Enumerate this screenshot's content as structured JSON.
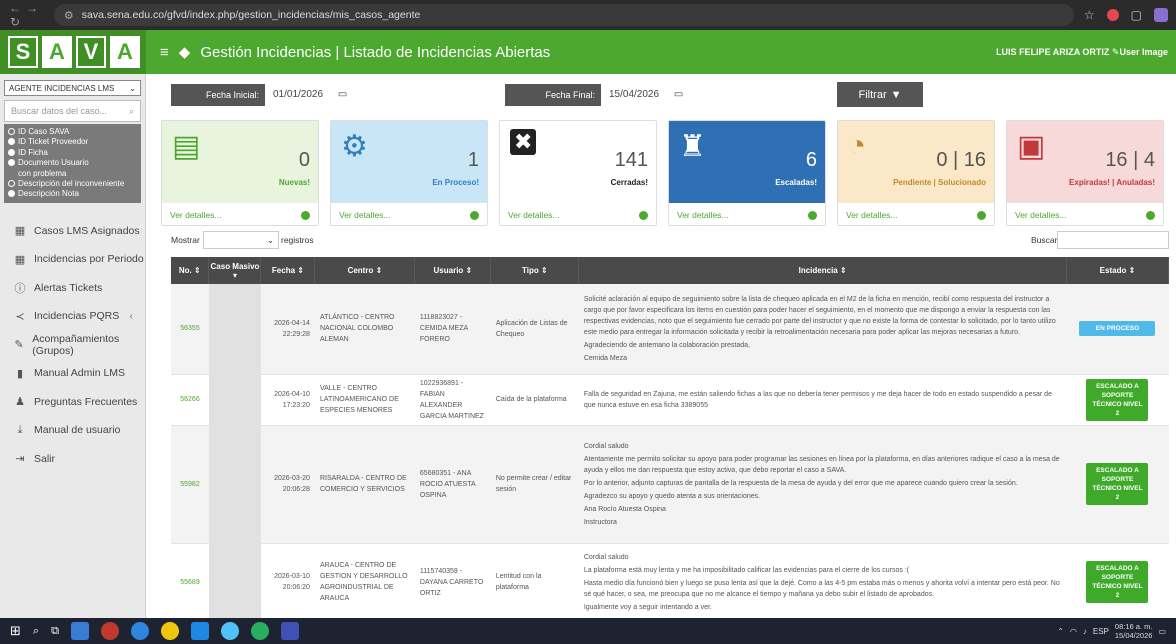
{
  "browser": {
    "url": "sava.sena.edu.co/gfvd/index.php/gestion_incidencias/mis_casos_agente"
  },
  "header": {
    "logo_letters": [
      "S",
      "A",
      "V",
      "A"
    ],
    "title": "Gestión Incidencias | Listado de Incidencias Abiertas",
    "user": "LUIS FELIPE ARIZA ORTIZ",
    "user_image": "User Image",
    "brand_color": "#4da830"
  },
  "sidebar": {
    "agent_select": "AGENTE INCIDENCIAS LMS",
    "search_placeholder": "Buscar datos del caso...",
    "filters": [
      {
        "label": "ID Caso SAVA",
        "selected": false
      },
      {
        "label": "ID Ticket Proveedor",
        "selected": true
      },
      {
        "label": "ID Ficha",
        "selected": true
      },
      {
        "label": "Documento Usuario",
        "selected": true
      },
      {
        "label": "con problema",
        "selected": false
      },
      {
        "label": "Descripción del inconveniente",
        "selected": false
      },
      {
        "label": "Descripción Nota",
        "selected": true
      }
    ],
    "menu": [
      {
        "label": "Casos LMS Asignados",
        "icon": "calendar-icon"
      },
      {
        "label": "Incidencias por Periodo",
        "icon": "calendar-icon"
      },
      {
        "label": "Alertas Tickets",
        "icon": "info-icon"
      },
      {
        "label": "Incidencias PQRS",
        "icon": "share-icon"
      },
      {
        "label": "Acompañamientos (Grupos)",
        "icon": "edit-icon"
      },
      {
        "label": "Manual Admin LMS",
        "icon": "book-icon"
      },
      {
        "label": "Preguntas Frecuentes",
        "icon": "users-icon"
      },
      {
        "label": "Manual de usuario",
        "icon": "download-icon"
      },
      {
        "label": "Salir",
        "icon": "logout-icon"
      }
    ]
  },
  "dates": {
    "start_label": "Fecha Inicial:",
    "start_value": "01/01/2026",
    "end_label": "Fecha Final:",
    "end_value": "15/04/2026",
    "filter_button": "Filtrar"
  },
  "cards": [
    {
      "number": "0",
      "label": "Nuevas!",
      "details": "Ver detalles...",
      "bg": "#e8f4de",
      "accent": "#4da830"
    },
    {
      "number": "1",
      "label": "En Proceso!",
      "details": "Ver detalles...",
      "bg": "#c8e6f5",
      "accent": "#2f7fc1"
    },
    {
      "number": "141",
      "label": "Cerradas!",
      "details": "Ver detalles...",
      "bg": "#ffffff",
      "accent": "#222222"
    },
    {
      "number": "6",
      "label": "Escaladas!",
      "details": "Ver detalles...",
      "bg": "#2f6fb3",
      "accent": "#ffffff"
    },
    {
      "number": "0 | 16",
      "label": "Pendiente | Solucionado",
      "details": "Ver detalles...",
      "bg": "#fbe8c8",
      "accent": "#c08a2a"
    },
    {
      "number": "16 | 4",
      "label": "Expiradas! | Anuladas!",
      "details": "Ver detalles...",
      "bg": "#f8d9da",
      "accent": "#c0393b"
    }
  ],
  "table": {
    "show_label": "Mostrar",
    "records_label": "registros",
    "search_label": "Buscar:",
    "columns": [
      "No.",
      "Caso Masivo",
      "Fecha",
      "Centro",
      "Usuario",
      "Tipo",
      "Incidencia",
      "Estado"
    ],
    "rows": [
      {
        "id": "56355",
        "fecha": "2026-04-14 22:29:28",
        "centro": "ATLÁNTICO - CENTRO NACIONAL COLOMBO ALEMAN",
        "usuario": "1118823027 - CEMIDA MEZA FORERO",
        "tipo": "Aplicación de Listas de Chequeo",
        "incidencia": [
          "Solicité aclaración al equipo de seguimiento sobre la lista de chequeo aplicada en el M2 de la ficha en mención, recibí como respuesta del instructor a cargo que por favor especificara los items en cuestión para poder hacer el seguimiento, en el momento que me dispongo a enviar la respuesta con las respectivas evidencias, noto que el seguimiento fue cerrado por parte del instructor y que no existe la forma de contestar lo solicitado, por lo tanto utilizo este medio para entregar la información solicitada y recibir la retroalimentación necesaria para poder aplicar las mejoras necesarias a futuro.",
          "Agradeciendo de antemano la colaboración prestada,",
          "Cemida Meza"
        ],
        "estado": "EN PROCESO",
        "estado_color": "#4fb9e8"
      },
      {
        "id": "56266",
        "fecha": "2026-04-10 17:23:20",
        "centro": "VALLE - CENTRO LATINOAMERICANO DE ESPECIES MENORES",
        "usuario": "1022936891 - FABIAN ALEXANDER GARCIA MARTINEZ",
        "tipo": "Caída de la plataforma",
        "incidencia": [
          "Falla de seguridad en Zajuna, me están saliendo fichas a las que no debería tener permisos y me deja hacer de todo en estado suspendido a pesar de que nunca estuve en esa ficha 3389055"
        ],
        "estado": "ESCALADO A SOPORTE TÉCNICO NIVEL 2",
        "estado_color": "#3faa2a"
      },
      {
        "id": "55982",
        "fecha": "2026-03-20 20:06:28",
        "centro": "RISARALDA - CENTRO DE COMERCIO Y SERVICIOS",
        "usuario": "65680351 - ANA ROCIO ATUESTA OSPINA",
        "tipo": "No permite crear / editar sesión",
        "incidencia": [
          "Cordial saludo",
          "Atentamente me permito solicitar su apoyo para poder programar las sesiones en línea por la plataforma, en días anteriores radique el caso a la mesa de ayuda y ellos me dan respuesta que estoy activa, que debo reportar el caso a SAVA.",
          "Por lo anterior, adjunto capturas de pantalla de la respuesta de la mesa de ayuda y del error que me aparece cuando quiero crear la sesión.",
          "Agradezco su apoyo y quedo atenta a sus orientaciones.",
          "Ana Rocío Atuesta Ospina",
          "Instructora"
        ],
        "estado": "ESCALADO A SOPORTE TÉCNICO NIVEL 2",
        "estado_color": "#3faa2a"
      },
      {
        "id": "55689",
        "fecha": "2026-03-10 20:06:20",
        "centro": "ARAUCA - CENTRO DE GESTION Y DESARROLLO AGROINDUSTRIAL DE ARAUCA",
        "usuario": "1115740359 - DAYANA CARRETO ORTIZ",
        "tipo": "Lentitud con la plataforma",
        "incidencia": [
          "Cordial saludo",
          "La plataforma está muy lenta y me ha imposibilitado calificar las evidencias para el cierre de los cursos :(",
          "Hasta medio día funcionó bien y luego se puso lenta así que la dejé. Como a las 4-5 pm estaba más o menos y ahorita volví a intentar pero está peor. No sé qué hacer, o sea, me preocupa que no me alcance el tiempo y mañana ya debo subir el listado de aprobados.",
          "Igualmente voy a seguir intentando a ver."
        ],
        "estado": "ESCALADO A SOPORTE TÉCNICO NIVEL 2",
        "estado_color": "#3faa2a"
      }
    ]
  },
  "taskbar": {
    "lang": "ESP",
    "time": "08:16 a. m.",
    "date": "15/04/2026"
  }
}
